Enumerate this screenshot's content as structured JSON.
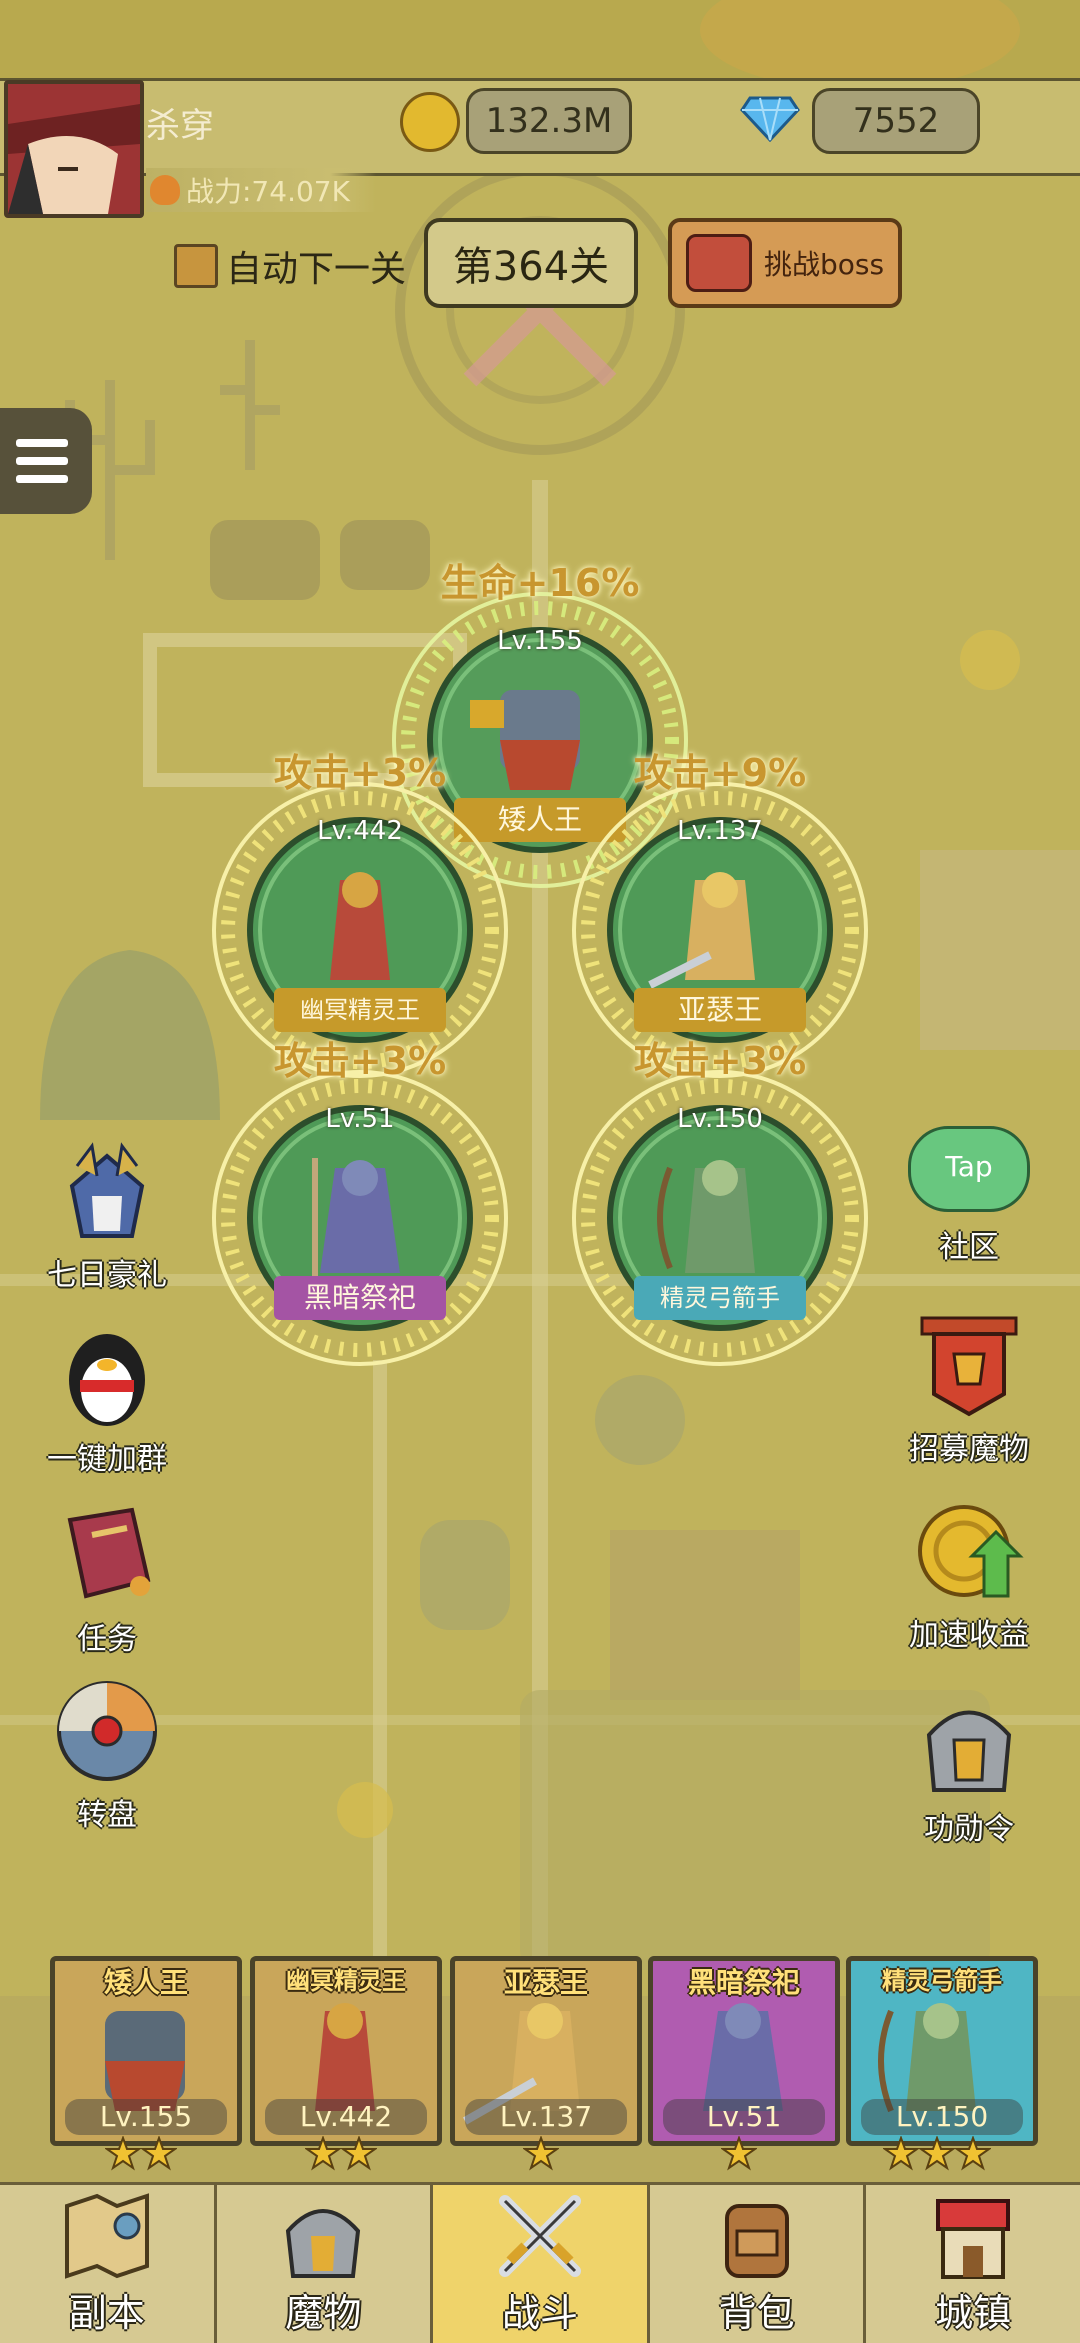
{
  "player": {
    "name": "杀穿",
    "power": "战力:74.07K"
  },
  "currency": {
    "gold": "132.3M",
    "gems": "7552"
  },
  "controls": {
    "auto_next": "自动下一关",
    "stage": "第364关",
    "boss_button": "挑战boss"
  },
  "formation": [
    {
      "buff": "生命+16%",
      "level": "Lv.155",
      "name": "矮人王"
    },
    {
      "buff": "攻击+3%",
      "level": "Lv.442",
      "name": "幽冥精灵王"
    },
    {
      "buff": "攻击+9%",
      "level": "Lv.137",
      "name": "亚瑟王"
    },
    {
      "buff": "攻击+3%",
      "level": "Lv.51",
      "name": "黑暗祭祀"
    },
    {
      "buff": "攻击+3%",
      "level": "Lv.150",
      "name": "精灵弓箭手"
    }
  ],
  "left_menu": [
    {
      "label": "七日豪礼",
      "icon": "warrior-gift-icon"
    },
    {
      "label": "一键加群",
      "icon": "penguin-icon"
    },
    {
      "label": "任务",
      "icon": "quest-book-icon"
    },
    {
      "label": "转盘",
      "icon": "wheel-icon"
    }
  ],
  "right_menu": [
    {
      "label": "社区",
      "icon": "tap-community-icon",
      "badge": "Tap"
    },
    {
      "label": "招募魔物",
      "icon": "recruit-banner-icon"
    },
    {
      "label": "加速收益",
      "icon": "gold-coin-arrow-icon"
    },
    {
      "label": "功勋令",
      "icon": "helmet-medal-icon"
    }
  ],
  "team": [
    {
      "name": "矮人王",
      "level": "Lv.155",
      "stars": 2,
      "color": "#c9a65a"
    },
    {
      "name": "幽冥精灵王",
      "level": "Lv.442",
      "stars": 2,
      "color": "#c9a65a"
    },
    {
      "name": "亚瑟王",
      "level": "Lv.137",
      "stars": 1,
      "color": "#c9a65a"
    },
    {
      "name": "黑暗祭祀",
      "level": "Lv.51",
      "stars": 1,
      "color": "#b05cb0"
    },
    {
      "name": "精灵弓箭手",
      "level": "Lv.150",
      "stars": 3,
      "color": "#4fb6c4"
    }
  ],
  "nav": [
    {
      "label": "副本",
      "icon": "map-icon",
      "active": false
    },
    {
      "label": "魔物",
      "icon": "monster-helmet-icon",
      "active": false
    },
    {
      "label": "战斗",
      "icon": "crossed-swords-icon",
      "active": true
    },
    {
      "label": "背包",
      "icon": "backpack-icon",
      "active": false
    },
    {
      "label": "城镇",
      "icon": "town-shop-icon",
      "active": false
    }
  ]
}
